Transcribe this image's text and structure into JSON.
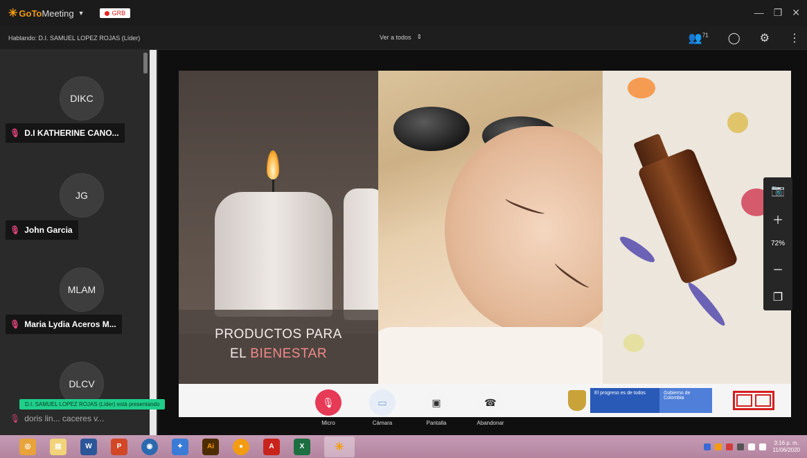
{
  "app": {
    "name_go": "GoTo",
    "name_meeting": "Meeting",
    "rec_label": "GRB"
  },
  "infobar": {
    "speaking": "Hablando: D.I. SAMUEL LOPEZ ROJAS (Líder)",
    "view_all": "Ver a todos",
    "attendee_count": "71"
  },
  "participants": [
    {
      "initials": "DIKC",
      "name": "D.I KATHERINE CANO..."
    },
    {
      "initials": "JG",
      "name": "John Garcia"
    },
    {
      "initials": "MLAM",
      "name": "Maria Lydia Aceros M..."
    },
    {
      "initials": "DLCV",
      "name": "doris lin... caceres v..."
    }
  ],
  "toast": "D.I. SAMUEL LOPEZ ROJAS (Líder) está presentando",
  "slide": {
    "title_line1": "PRODUCTOS PARA",
    "title_line2_a": "EL ",
    "title_line2_b": "BIENESTAR",
    "gov_text_a": "El progreso es de todos",
    "gov_text_b": "Gobierno de Colombia"
  },
  "zoom": {
    "percent": "72%"
  },
  "controls": [
    {
      "label": "Micro"
    },
    {
      "label": "Cámara"
    },
    {
      "label": "Pantalla"
    },
    {
      "label": "Abandonar"
    }
  ],
  "clock": {
    "time": "3:16 p. m.",
    "date": "11/06/2020"
  },
  "colors": {
    "accent": "#e63a57",
    "toast": "#1fcf8a",
    "taskbar": "#b4849f"
  }
}
